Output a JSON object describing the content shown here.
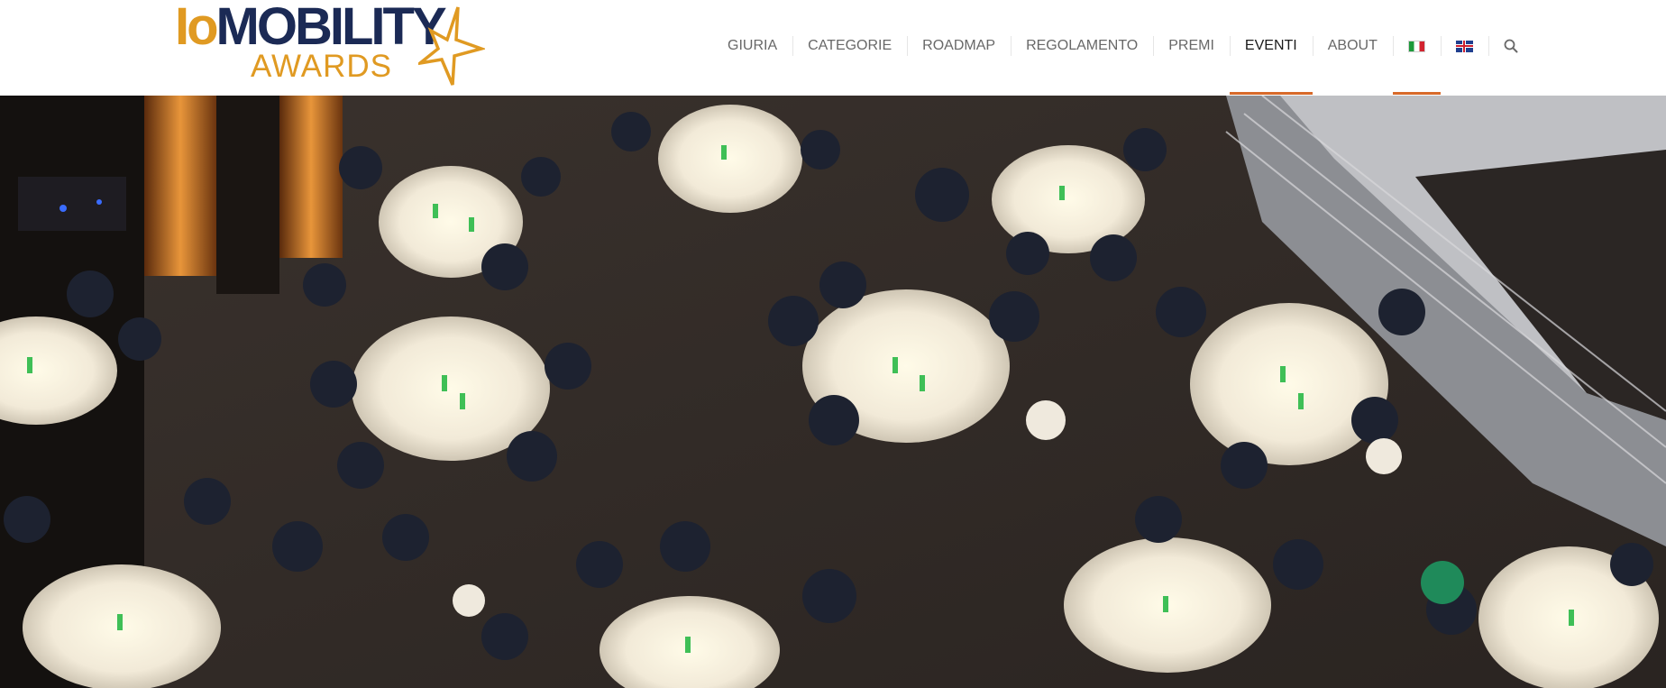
{
  "brand": {
    "logo_prefix": "Io",
    "logo_main": "MOBILITY",
    "logo_sub": "AWARDS",
    "colors": {
      "navy": "#1b2a55",
      "orange": "#e09a22",
      "accent": "#d86a2a"
    }
  },
  "nav": {
    "items": [
      {
        "label": "GIURIA",
        "active": false
      },
      {
        "label": "CATEGORIE",
        "active": false
      },
      {
        "label": "ROADMAP",
        "active": false
      },
      {
        "label": "REGOLAMENTO",
        "active": false
      },
      {
        "label": "PREMI",
        "active": false
      },
      {
        "label": "EVENTI",
        "active": true
      },
      {
        "label": "ABOUT",
        "active": false
      }
    ],
    "languages": [
      {
        "icon": "italian-flag-icon",
        "selected": true
      },
      {
        "icon": "uk-flag-icon",
        "selected": false
      }
    ],
    "search_icon": "search-icon"
  },
  "hero": {
    "image_icon": "gala-dinner-photo"
  }
}
